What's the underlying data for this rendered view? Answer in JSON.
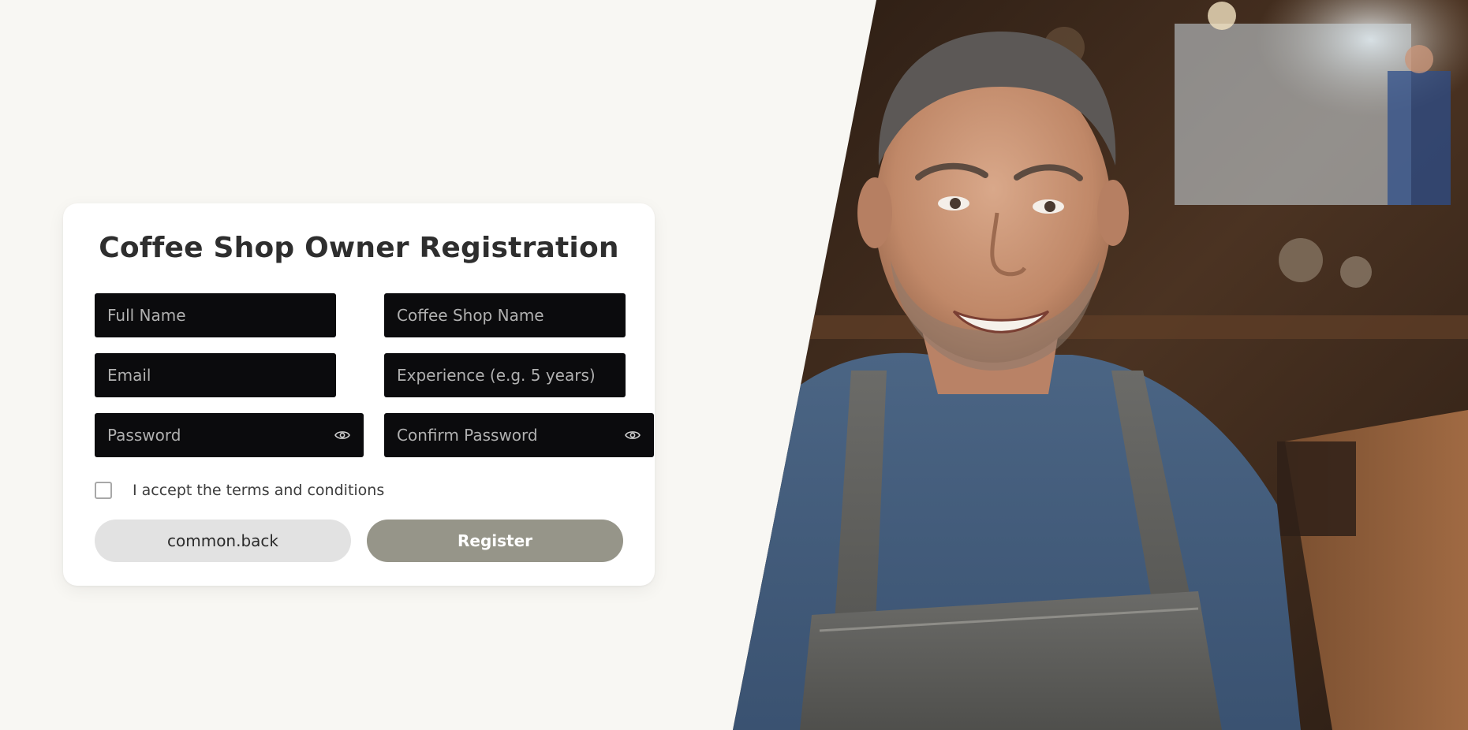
{
  "form": {
    "title": "Coffee Shop Owner Registration",
    "fields": {
      "full_name": {
        "placeholder": "Full Name",
        "value": ""
      },
      "shop_name": {
        "placeholder": "Coffee Shop Name",
        "value": ""
      },
      "email": {
        "placeholder": "Email",
        "value": ""
      },
      "experience": {
        "placeholder": "Experience (e.g. 5 years)",
        "value": ""
      },
      "password": {
        "placeholder": "Password",
        "value": ""
      },
      "confirm_password": {
        "placeholder": "Confirm Password",
        "value": ""
      }
    },
    "terms_label": "I accept the terms and conditions",
    "terms_checked": false,
    "back_label": "common.back",
    "register_label": "Register"
  },
  "icons": {
    "password_toggle": "eye-icon",
    "confirm_password_toggle": "eye-icon"
  },
  "colors": {
    "page_background": "#f8f7f3",
    "card_background": "#ffffff",
    "input_background": "#0b0b0d",
    "back_button": "#e2e2e2",
    "register_button": "#969589",
    "title_text": "#2e2e2e"
  },
  "hero_image": {
    "subject": "smiling coffee shop owner in blue t-shirt and grey apron"
  }
}
